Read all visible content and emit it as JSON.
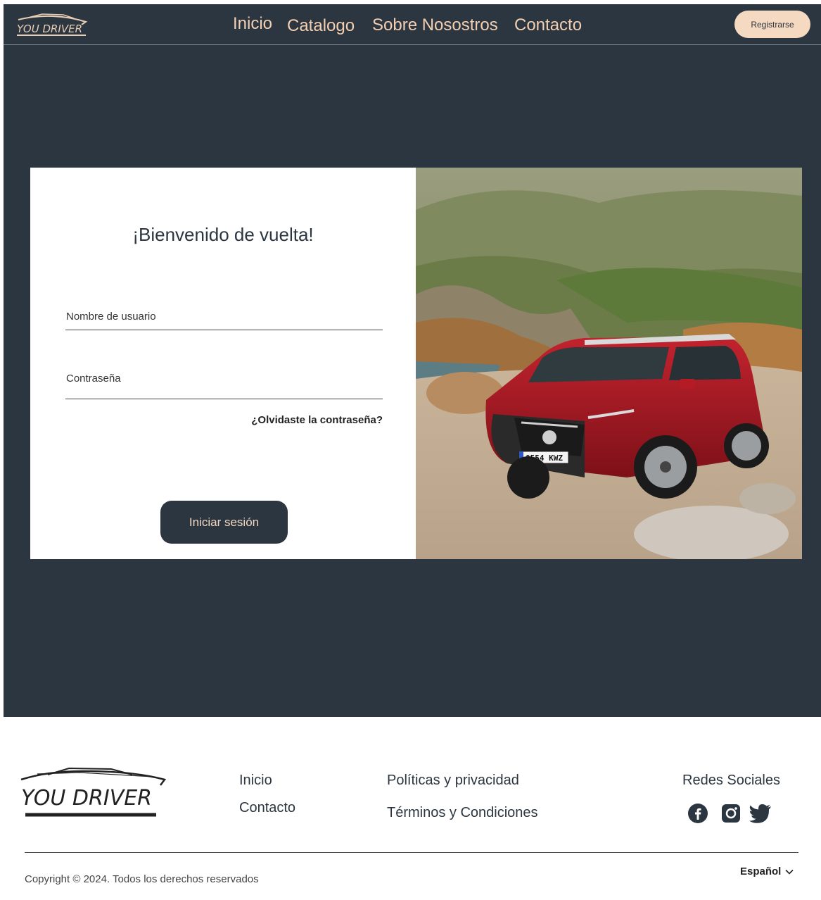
{
  "header": {
    "brand": "YOU DRIVER",
    "nav": [
      {
        "label": "Inicio"
      },
      {
        "label": "Catalogo"
      },
      {
        "label": "Sobre Nosostros"
      },
      {
        "label": "Contacto"
      }
    ],
    "register_label": "Registrarse"
  },
  "login": {
    "title": "¡Bienvenido de vuelta!",
    "username_placeholder": "Nombre de usuario",
    "password_placeholder": "Contraseña",
    "forgot_label": "¿Olvidaste la contraseña?",
    "submit_label": "Iniciar sesión",
    "plate": "0554 KWZ"
  },
  "footer": {
    "brand": "YOU DRIVER",
    "links_col1": [
      {
        "label": "Inicio"
      },
      {
        "label": "Contacto"
      }
    ],
    "links_col2": [
      {
        "label": "Políticas y privacidad"
      },
      {
        "label": "Términos y Condiciones"
      }
    ],
    "social_title": "Redes Sociales",
    "social_icons": [
      "facebook-icon",
      "instagram-icon",
      "twitter-icon"
    ],
    "copyright": "Copyright © 2024. Todos los derechos reservados",
    "language": "Español"
  },
  "colors": {
    "dark": "#2c3640",
    "accent": "#f3cfb2",
    "button_light": "#f6d9c1"
  }
}
